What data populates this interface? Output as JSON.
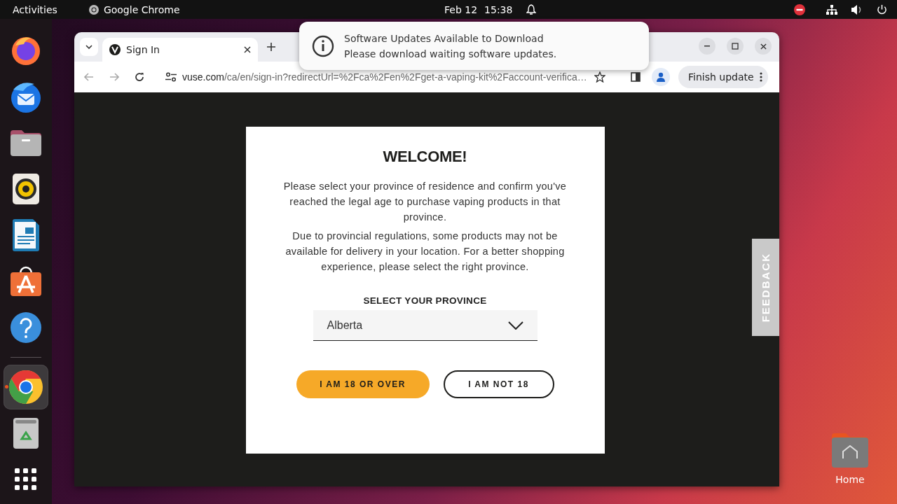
{
  "top_bar": {
    "activities": "Activities",
    "app_name": "Google Chrome",
    "date": "Feb 12",
    "time": "15:38"
  },
  "dock": [
    {
      "kind": "firefox",
      "selected": false
    },
    {
      "kind": "thunderbird",
      "selected": false
    },
    {
      "kind": "files",
      "selected": false
    },
    {
      "kind": "rhythmbox",
      "selected": false
    },
    {
      "kind": "writer",
      "selected": false
    },
    {
      "kind": "appcenter",
      "selected": false
    },
    {
      "kind": "help",
      "selected": false
    },
    {
      "kind": "separator"
    },
    {
      "kind": "chrome",
      "selected": true,
      "running": true
    },
    {
      "kind": "trash",
      "selected": false
    },
    {
      "kind": "apps",
      "selected": false
    }
  ],
  "browser": {
    "tabs": [
      {
        "title": "Sign In",
        "selected": true
      }
    ],
    "address": {
      "host": "vuse.com",
      "path": "/ca/en/sign-in?redirectUrl=%2Fca%2Fen%2Fget-a-vaping-kit%2Faccount-verifica…"
    },
    "update_button": "Finish update"
  },
  "dialog": {
    "title": "WELCOME!",
    "paragraphs": [
      "Please select your province of residence and confirm you've reached the legal age to purchase vaping products in that province.",
      "Due to provincial regulations, some products may not be available for delivery in your location. For a better shopping experience, please select the right province."
    ],
    "province_label": "SELECT YOUR PROVINCE",
    "province": {
      "value": "Alberta"
    },
    "buttons": [
      {
        "label": "I AM 18 OR OVER",
        "kind": "primary"
      },
      {
        "label": "I AM NOT 18",
        "kind": "outline"
      }
    ]
  },
  "feedback_tab": "FEEDBACK",
  "notification": {
    "title": "Software Updates Available to Download",
    "body": "Please download waiting software updates."
  },
  "desktop_icons": [
    {
      "label": "Home"
    }
  ]
}
